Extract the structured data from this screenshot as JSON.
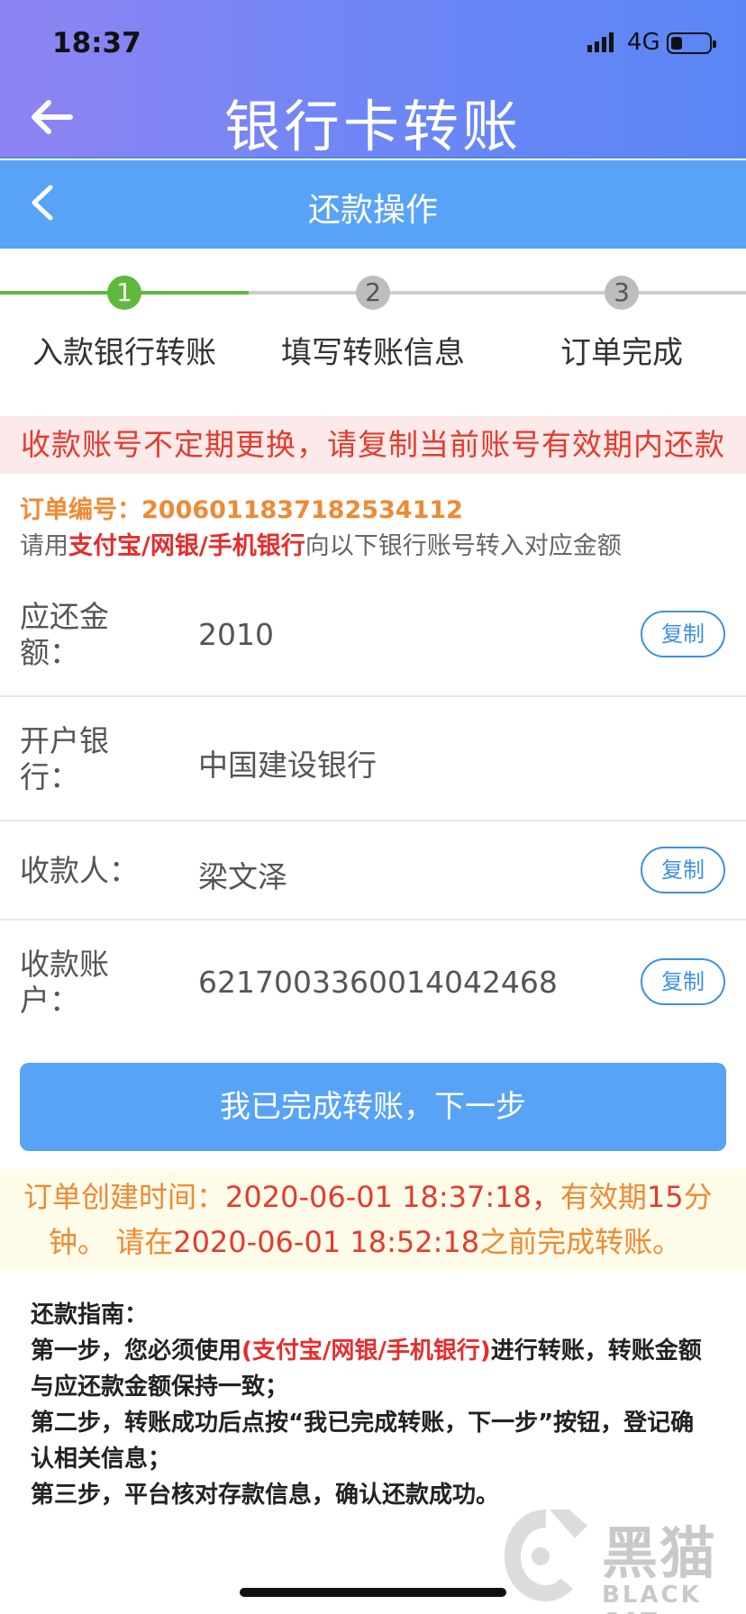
{
  "status_bar": {
    "time": "18:37",
    "network": "4G",
    "battery_level": 0.25
  },
  "header": {
    "title": "银行卡转账"
  },
  "subheader": {
    "title": "还款操作"
  },
  "steps": [
    {
      "number": "1",
      "label": "入款银行转账",
      "active": true
    },
    {
      "number": "2",
      "label": "填写转账信息",
      "active": false
    },
    {
      "number": "3",
      "label": "订单完成",
      "active": false
    }
  ],
  "warning": "收款账号不定期更换，请复制当前账号有效期内还款",
  "order": {
    "number_text": "订单编号：2006011837182534112",
    "hint_prefix": "请用",
    "hint_highlight": "支付宝/网银/手机银行",
    "hint_suffix": "向以下银行账号转入对应金额"
  },
  "fields": {
    "amount": {
      "label_l1": "应还金",
      "label_l2": "额：",
      "value": "2010",
      "copy_label": "复制"
    },
    "bank": {
      "label_l1": "开户银",
      "label_l2": "行：",
      "value": "中国建设银行"
    },
    "payee": {
      "label": "收款人：",
      "value": "梁文泽",
      "copy_label": "复制"
    },
    "account": {
      "label_l1": "收款账",
      "label_l2": "户：",
      "value": "6217003360014042468",
      "copy_label": "复制"
    }
  },
  "next_button": "我已完成转账，下一步",
  "time_notice": {
    "part1": "订单创建时间：",
    "part2": "2020-06-01 18:37:18，",
    "part3": "有效期",
    "part4": "15",
    "part5": "分",
    "part6": "钟。 ",
    "part7": "请在",
    "part8": "2020-06-01 18:52:18",
    "part9": "之前完成转账。"
  },
  "guide": {
    "title": "还款指南：",
    "step1_prefix": "第一步，您必须使用",
    "step1_highlight": "(支付宝/网银/手机银行)",
    "step1_suffix": "进行转账，转账金额与应还款金额保持一致；",
    "step2": "第二步，转账成功后点按“我已完成转账，下一步”按钮，登记确认相关信息；",
    "step3": "第三步，平台核对存款信息，确认还款成功。"
  },
  "watermark": {
    "text": "黑猫",
    "sub": "BLACK CAT"
  }
}
